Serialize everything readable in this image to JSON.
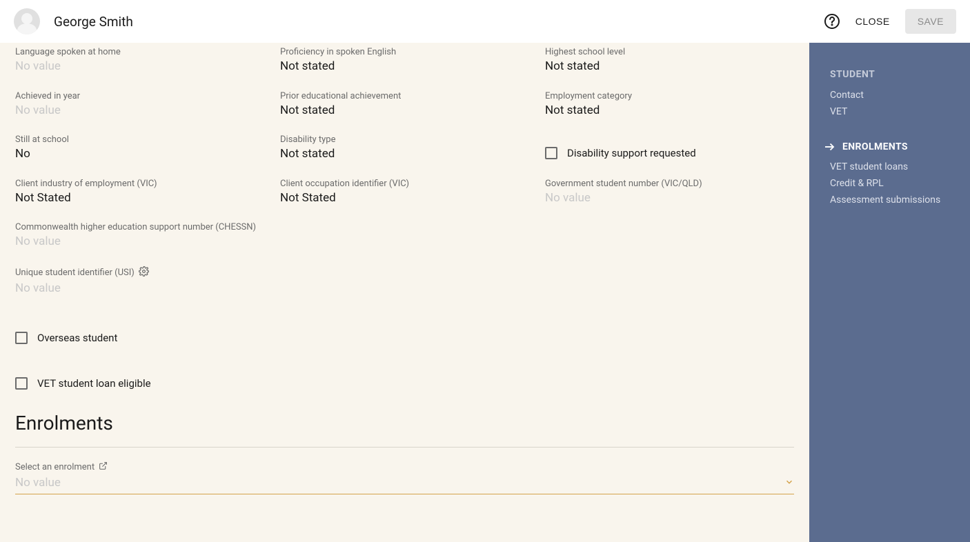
{
  "header": {
    "student_name": "George Smith",
    "close_label": "CLOSE",
    "save_label": "SAVE"
  },
  "fields": {
    "language_home": {
      "label": "Language spoken at home",
      "value": "No value",
      "novalue": true
    },
    "proficiency": {
      "label": "Proficiency in spoken English",
      "value": "Not stated",
      "novalue": false
    },
    "highest_school": {
      "label": "Highest school level",
      "value": "Not stated",
      "novalue": false
    },
    "achieved_year": {
      "label": "Achieved in year",
      "value": "No value",
      "novalue": true
    },
    "prior_edu": {
      "label": "Prior educational achievement",
      "value": "Not stated",
      "novalue": false
    },
    "employment_cat": {
      "label": "Employment category",
      "value": "Not stated",
      "novalue": false
    },
    "still_school": {
      "label": "Still at school",
      "value": "No",
      "novalue": false
    },
    "disability_type": {
      "label": "Disability type",
      "value": "Not stated",
      "novalue": false
    },
    "disability_support": {
      "label": "Disability support requested"
    },
    "client_industry": {
      "label": "Client industry of employment (VIC)",
      "value": "Not Stated",
      "novalue": false
    },
    "client_occupation": {
      "label": "Client occupation identifier (VIC)",
      "value": "Not Stated",
      "novalue": false
    },
    "gov_student_num": {
      "label": "Government student number (VIC/QLD)",
      "value": "No value",
      "novalue": true
    },
    "chessn": {
      "label": "Commonwealth higher education support number (CHESSN)",
      "value": "No value",
      "novalue": true
    },
    "usi": {
      "label": "Unique student identifier (USI)",
      "value": "No value",
      "novalue": true
    }
  },
  "checkboxes": {
    "overseas": "Overseas student",
    "vet_loan": "VET student loan eligible"
  },
  "enrolments": {
    "heading": "Enrolments",
    "select_label": "Select an enrolment",
    "select_placeholder": "No value"
  },
  "sidebar": {
    "student_heading": "STUDENT",
    "items": {
      "contact": "Contact",
      "vet": "VET",
      "enrolments": "Enrolments",
      "vet_loans": "VET student loans",
      "credit_rpl": "Credit & RPL",
      "assessment": "Assessment submissions"
    }
  }
}
